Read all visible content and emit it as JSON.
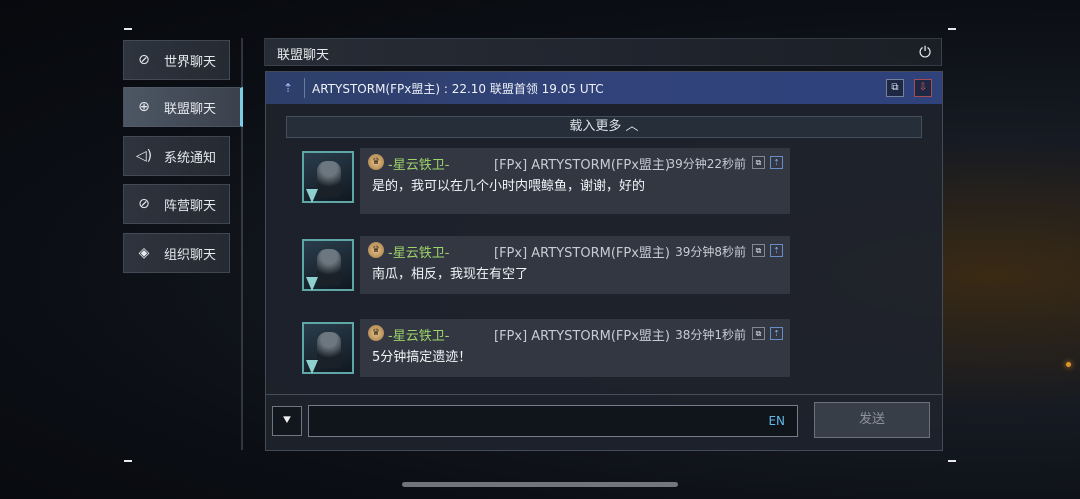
{
  "sidebar": {
    "items": [
      {
        "label": "世界聊天",
        "icon": "planet-icon",
        "glyph": "⊘"
      },
      {
        "label": "联盟聊天",
        "icon": "globe-icon",
        "glyph": "⊕"
      },
      {
        "label": "系统通知",
        "icon": "speaker-icon",
        "glyph": "◁)"
      },
      {
        "label": "阵营聊天",
        "icon": "planet-icon",
        "glyph": "⊘"
      },
      {
        "label": "组织聊天",
        "icon": "diamond-icon",
        "glyph": "◈"
      }
    ],
    "active_index": 1
  },
  "header": {
    "title": "联盟聊天",
    "power_glyph": "⏻"
  },
  "pinned": {
    "icon_glyph": "⇡",
    "text": "ARTYSTORM(FPx盟主) : 22.10 联盟首领 19.05 UTC",
    "copy_glyph": "⧉",
    "download_glyph": "⇩"
  },
  "load_more": "载入更多 ︿",
  "messages": [
    {
      "guild": "-星云铁卫-",
      "sender": "[FPx] ARTYSTORM(FPx盟主)",
      "time": "39分钟22秒前",
      "text": "是的，我可以在几个小时内喂鲸鱼，谢谢，好的"
    },
    {
      "guild": "-星云铁卫-",
      "sender": "[FPx] ARTYSTORM(FPx盟主)",
      "time": "39分钟8秒前",
      "text": "南瓜，相反，我现在有空了"
    },
    {
      "guild": "-星云铁卫-",
      "sender": "[FPx] ARTYSTORM(FPx盟主)",
      "time": "38分钟1秒前",
      "text": "5分钟搞定遗迹！"
    }
  ],
  "input": {
    "toggle_glyph": "⯆",
    "lang": "EN",
    "value": ""
  },
  "send_label": "发送",
  "colors": {
    "guild": "#9cd36a",
    "pin_bar": "#31437a",
    "lang": "#63b8e8"
  }
}
